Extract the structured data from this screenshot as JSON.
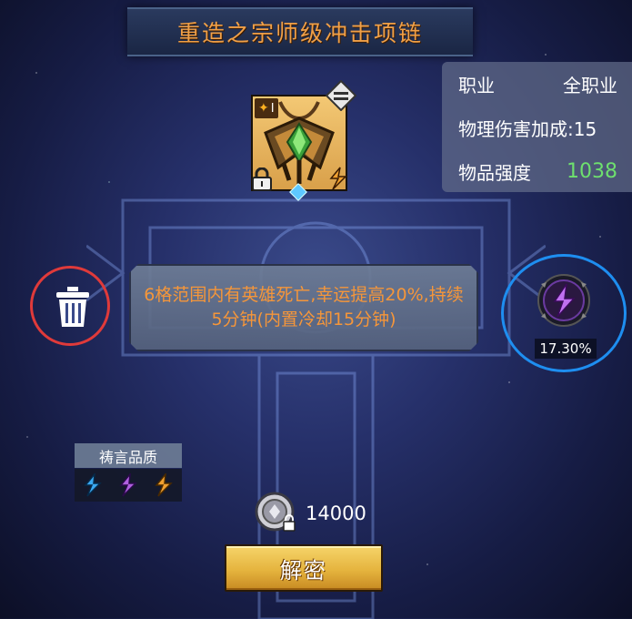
{
  "title": "重造之宗师级冲击项链",
  "item": {
    "tier": "I",
    "icons": [
      "necklace-icon",
      "equal-compare-icon",
      "lock-icon",
      "rune-icon",
      "gem-icon"
    ]
  },
  "stats": {
    "rows": [
      {
        "label": "职业",
        "value": "全职业"
      },
      {
        "label": "物理伤害加成:15",
        "value": ""
      },
      {
        "label": "物品强度",
        "value": "1038",
        "value_color": "#6ee06e"
      }
    ]
  },
  "description": "6格范围内有英雄死亡,幸运提高20%,持续5分钟(内置冷却15分钟)",
  "orb": {
    "percent": "17.30%",
    "icon": "purple-rune-orb-icon"
  },
  "trash": {
    "icon": "trash-icon",
    "ring_color": "#e03a3a"
  },
  "orb_ring_color": "#1e8ef0",
  "quality": {
    "title": "祷言品质",
    "runes": [
      {
        "icon": "blue-rune-icon",
        "color": "#3aa8f0"
      },
      {
        "icon": "purple-rune-icon",
        "color": "#b060e0"
      },
      {
        "icon": "gold-rune-icon",
        "color": "#f0a030"
      }
    ]
  },
  "cost": {
    "icon": "silver-coin-lock-icon",
    "amount": "14000"
  },
  "button": {
    "label": "解密"
  }
}
